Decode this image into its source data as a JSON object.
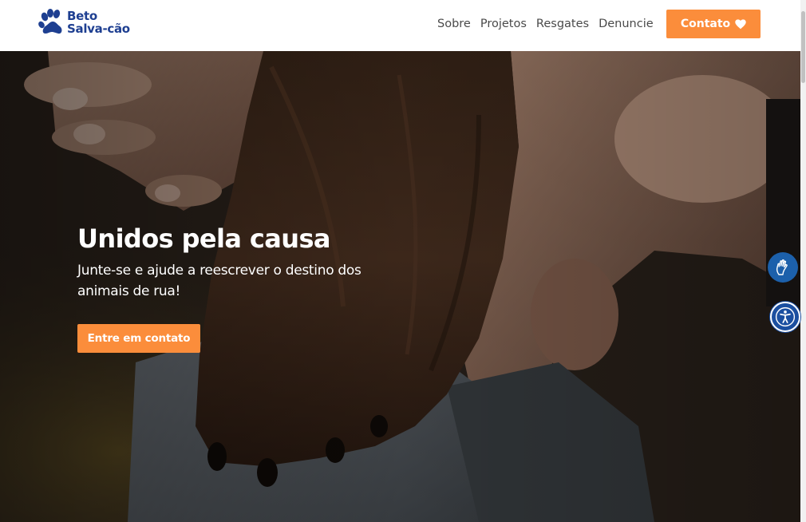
{
  "brand": {
    "line1": "Beto",
    "line2": "Salva-cão",
    "color": "#1e3f91"
  },
  "nav": {
    "items": [
      {
        "label": "Sobre"
      },
      {
        "label": "Projetos"
      },
      {
        "label": "Resgates"
      },
      {
        "label": "Denuncie"
      }
    ],
    "contact_label": "Contato",
    "contact_icon": "heart-icon"
  },
  "hero": {
    "title": "Unidos pela causa",
    "subtitle": "Junte-se e ajude a reescrever o destino dos animais de rua!",
    "cta_label": "Entre em contato",
    "image": "hand-holding-dog-paw-photo"
  },
  "widgets": {
    "sign_language_icon": "hand-sign-icon",
    "accessibility_icon": "accessibility-icon"
  },
  "colors": {
    "accent": "#fb8d3b",
    "brand": "#1e3f91",
    "widget": "#1c60ab"
  }
}
